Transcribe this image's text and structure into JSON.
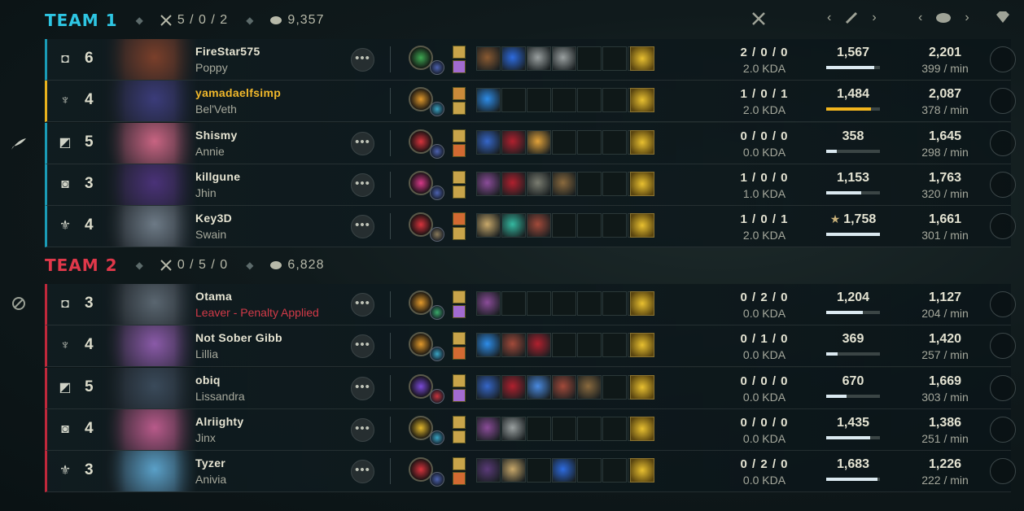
{
  "team1": {
    "title": "TEAM 1",
    "color": "#2ec6e3",
    "kda": "5 / 0 / 2",
    "gold": "9,357",
    "players": [
      {
        "role_icon": "top-icon",
        "level": "6",
        "name": "FireStar575",
        "champion": "Poppy",
        "kda": "2 / 0 / 0",
        "kda_ratio": "2.0 KDA",
        "damage": "1,567",
        "damage_ratio": 0.89,
        "gold": "2,201",
        "gpm": "399 / min",
        "portrait": "#7a3f2a",
        "keystone": "#3ea852",
        "secondary_rune": "#4d62b0",
        "spell1": "#c8a44a",
        "spell2": "#a26bd0",
        "items": [
          "#8a5a32",
          "#2d6be0",
          "#9aa0a0",
          "#9aa0a0",
          "",
          "",
          ""
        ],
        "highlight": false,
        "more": true,
        "star": false
      },
      {
        "role_icon": "jungle-icon",
        "level": "4",
        "name": "yamadaelfsimp",
        "champion": "Bel'Veth",
        "kda": "1 / 0 / 1",
        "kda_ratio": "2.0 KDA",
        "damage": "1,484",
        "damage_ratio": 0.84,
        "gold": "2,087",
        "gpm": "378 / min",
        "portrait": "#3b3c7a",
        "keystone": "#e39a2c",
        "secondary_rune": "#3aa4c4",
        "spell1": "#c98a3a",
        "spell2": "#c8a44a",
        "items": [
          "#2d8ce8",
          "",
          "",
          "",
          "",
          "",
          ""
        ],
        "highlight": true,
        "more": false,
        "star": false
      },
      {
        "role_icon": "mid-icon",
        "level": "5",
        "name": "Shismy",
        "champion": "Annie",
        "kda": "0 / 0 / 0",
        "kda_ratio": "0.0 KDA",
        "damage": "358",
        "damage_ratio": 0.2,
        "gold": "1,645",
        "gpm": "298 / min",
        "portrait": "#c86482",
        "keystone": "#d8343d",
        "secondary_rune": "#4d62b0",
        "spell1": "#c8a44a",
        "spell2": "#d26a32",
        "items": [
          "#3566c8",
          "#b0202e",
          "#e2a23a",
          "",
          "",
          "",
          ""
        ],
        "highlight": false,
        "more": true,
        "star": false
      },
      {
        "role_icon": "bottom-icon",
        "level": "3",
        "name": "killgune",
        "champion": "Jhin",
        "kda": "1 / 0 / 0",
        "kda_ratio": "1.0 KDA",
        "damage": "1,153",
        "damage_ratio": 0.65,
        "gold": "1,763",
        "gpm": "320 / min",
        "portrait": "#4a3278",
        "keystone": "#d83a8a",
        "secondary_rune": "#4d62b0",
        "spell1": "#c8a44a",
        "spell2": "#c8a44a",
        "items": [
          "#8a4c98",
          "#b0202e",
          "#7a7c70",
          "#8a6a3e",
          "",
          "",
          ""
        ],
        "highlight": false,
        "more": true,
        "star": false
      },
      {
        "role_icon": "support-icon",
        "level": "4",
        "name": "Key3D",
        "champion": "Swain",
        "kda": "1 / 0 / 1",
        "kda_ratio": "2.0 KDA",
        "damage": "1,758",
        "damage_ratio": 1.0,
        "gold": "1,661",
        "gpm": "301 / min",
        "portrait": "#6d7a86",
        "keystone": "#d8343d",
        "secondary_rune": "#8a7a5a",
        "spell1": "#d26a32",
        "spell2": "#c8a44a",
        "items": [
          "#c8a86a",
          "#34b8a0",
          "#a24a3a",
          "",
          "",
          "",
          ""
        ],
        "highlight": false,
        "more": true,
        "star": true
      }
    ]
  },
  "team2": {
    "title": "TEAM 2",
    "color": "#e0384a",
    "kda": "0 / 5 / 0",
    "gold": "6,828",
    "players": [
      {
        "role_icon": "top-icon",
        "level": "3",
        "name": "Otama",
        "champion": "Leaver - Penalty Applied",
        "kda": "0 / 2 / 0",
        "kda_ratio": "0.0 KDA",
        "damage": "1,204",
        "damage_ratio": 0.68,
        "gold": "1,127",
        "gpm": "204 / min",
        "portrait": "#5a6670",
        "keystone": "#e39a2c",
        "secondary_rune": "#3aaa6a",
        "spell1": "#c8a44a",
        "spell2": "#a26bd0",
        "items": [
          "#8a4c98",
          "",
          "",
          "",
          "",
          "",
          ""
        ],
        "highlight": false,
        "more": true,
        "star": false,
        "leaver": true
      },
      {
        "role_icon": "jungle-icon",
        "level": "4",
        "name": "Not Sober Gibb",
        "champion": "Lillia",
        "kda": "0 / 1 / 0",
        "kda_ratio": "0.0 KDA",
        "damage": "369",
        "damage_ratio": 0.21,
        "gold": "1,420",
        "gpm": "257 / min",
        "portrait": "#8a5aa8",
        "keystone": "#e39a2c",
        "secondary_rune": "#3aa4c4",
        "spell1": "#c8a44a",
        "spell2": "#d26a32",
        "items": [
          "#2d8ce8",
          "#a24a3a",
          "#b0202e",
          "",
          "",
          "",
          ""
        ],
        "highlight": false,
        "more": true,
        "star": false
      },
      {
        "role_icon": "mid-icon",
        "level": "5",
        "name": "obiq",
        "champion": "Lissandra",
        "kda": "0 / 0 / 0",
        "kda_ratio": "0.0 KDA",
        "damage": "670",
        "damage_ratio": 0.38,
        "gold": "1,669",
        "gpm": "303 / min",
        "portrait": "#3a4a5a",
        "keystone": "#7a4ad8",
        "secondary_rune": "#c8343d",
        "spell1": "#c8a44a",
        "spell2": "#a26bd0",
        "items": [
          "#3566c8",
          "#b0202e",
          "#4a8ae0",
          "#a24a3a",
          "#8a6a3e",
          "",
          ""
        ],
        "highlight": false,
        "more": true,
        "star": false
      },
      {
        "role_icon": "bottom-icon",
        "level": "4",
        "name": "Alriighty",
        "champion": "Jinx",
        "kda": "0 / 0 / 0",
        "kda_ratio": "0.0 KDA",
        "damage": "1,435",
        "damage_ratio": 0.82,
        "gold": "1,386",
        "gpm": "251 / min",
        "portrait": "#b85a8a",
        "keystone": "#e3b82c",
        "secondary_rune": "#3aa4c4",
        "spell1": "#c8a44a",
        "spell2": "#c8a44a",
        "items": [
          "#8a4c98",
          "#9aa0a0",
          "",
          "",
          "",
          "",
          ""
        ],
        "highlight": false,
        "more": true,
        "star": false
      },
      {
        "role_icon": "support-icon",
        "level": "3",
        "name": "Tyzer",
        "champion": "Anivia",
        "kda": "0 / 2 / 0",
        "kda_ratio": "0.0 KDA",
        "damage": "1,683",
        "damage_ratio": 0.96,
        "gold": "1,226",
        "gpm": "222 / min",
        "portrait": "#5aa0c8",
        "keystone": "#d8343d",
        "secondary_rune": "#4d62b0",
        "spell1": "#c8a44a",
        "spell2": "#d26a32",
        "items": [
          "#5a3a78",
          "#c8a86a",
          "",
          "#2d6be0",
          "",
          "",
          ""
        ],
        "highlight": false,
        "more": true,
        "star": false
      }
    ]
  },
  "columns": {
    "kda_icon": "crossed-swords-icon",
    "damage_icon": "sword-icon",
    "gold_icon": "gold-coin-icon",
    "vision_icon": "diamond-icon"
  },
  "side_icons": [
    "feather-icon",
    "ban-icon"
  ]
}
